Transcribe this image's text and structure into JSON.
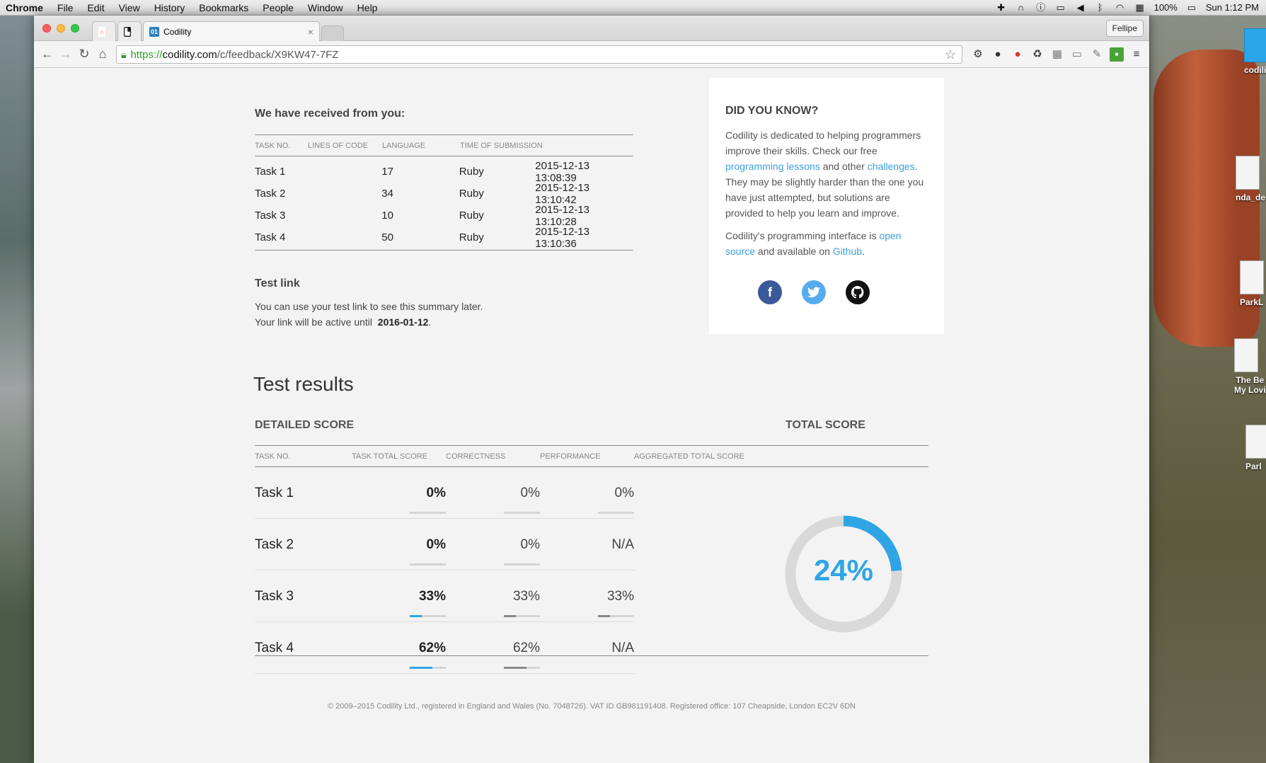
{
  "menubar": {
    "app": "Chrome",
    "items": [
      "File",
      "Edit",
      "View",
      "History",
      "Bookmarks",
      "People",
      "Window",
      "Help"
    ],
    "battery": "100%",
    "clock": "Sun 1:12 PM"
  },
  "browser": {
    "tab_title": "Codility",
    "tab_favicon": "01",
    "tab_close": "×",
    "profile_name": "Fellipe",
    "url_scheme": "https://",
    "url_host": "codility.com",
    "url_path": "/c/feedback/X9KW47-7FZ"
  },
  "received": {
    "heading": "We have received from you:",
    "headers": [
      "TASK NO.",
      "LINES OF CODE",
      "LANGUAGE",
      "TIME OF SUBMISSION"
    ],
    "rows": [
      {
        "task": "Task 1",
        "lines": "17",
        "lang": "Ruby",
        "time": "2015-12-13 13:08:39"
      },
      {
        "task": "Task 2",
        "lines": "34",
        "lang": "Ruby",
        "time": "2015-12-13 13:10:42"
      },
      {
        "task": "Task 3",
        "lines": "10",
        "lang": "Ruby",
        "time": "2015-12-13 13:10:28"
      },
      {
        "task": "Task 4",
        "lines": "50",
        "lang": "Ruby",
        "time": "2015-12-13 13:10:36"
      }
    ]
  },
  "test_link": {
    "heading": "Test link",
    "line1": "You can use your test link to see this summary later.",
    "line2_prefix": "Your link will be active until",
    "date": "2016-01-12",
    "line2_suffix": "."
  },
  "did_you_know": {
    "heading": "DID YOU KNOW?",
    "p1_a": "Codility is dedicated to helping programmers improve their skills. Check our free ",
    "p1_link1": "programming lessons",
    "p1_b": " and other ",
    "p1_link2": "challenges",
    "p1_c": ". They may be slightly harder than the one you have just attempted, but solutions are provided to help you learn and improve.",
    "p2_a": "Codility's programming interface is ",
    "p2_link1": "open source",
    "p2_b": " and available on ",
    "p2_link2": "Github",
    "p2_c": "."
  },
  "results": {
    "title": "Test results",
    "detailed_heading": "DETAILED SCORE",
    "total_heading": "TOTAL SCORE",
    "headers": [
      "TASK NO.",
      "TASK TOTAL SCORE",
      "CORRECTNESS",
      "PERFORMANCE",
      "AGGREGATED TOTAL SCORE"
    ],
    "rows": [
      {
        "task": "Task 1",
        "total": "0%",
        "correct": "0%",
        "perf": "0%",
        "total_v": 0,
        "correct_v": 0,
        "perf_v": 0
      },
      {
        "task": "Task 2",
        "total": "0%",
        "correct": "0%",
        "perf": "N/A",
        "total_v": 0,
        "correct_v": 0,
        "perf_v": null
      },
      {
        "task": "Task 3",
        "total": "33%",
        "correct": "33%",
        "perf": "33%",
        "total_v": 33,
        "correct_v": 33,
        "perf_v": 33
      },
      {
        "task": "Task 4",
        "total": "62%",
        "correct": "62%",
        "perf": "N/A",
        "total_v": 62,
        "correct_v": 62,
        "perf_v": null
      }
    ],
    "total_score": "24%",
    "total_score_value": 24
  },
  "footer": "© 2009–2015 Codility Ltd., registered in England and Wales (No. 7048726). VAT ID GB981191408. Registered office: 107 Cheapside, London EC2V 6DN",
  "desktop": [
    "codili",
    "nda_de",
    "ParkL",
    "The Be",
    "My Lovi",
    "Parl"
  ],
  "colors": {
    "accent": "#2fa5e6",
    "bar_total": "#2fa5e6",
    "bar_other": "#8a8a8a",
    "donut_track": "#d9d9d9"
  },
  "icons": {
    "back": "arrow-left-icon",
    "forward": "arrow-right-icon",
    "reload": "reload-icon",
    "home": "home-icon",
    "star": "star-icon",
    "menu": "hamburger-icon"
  }
}
